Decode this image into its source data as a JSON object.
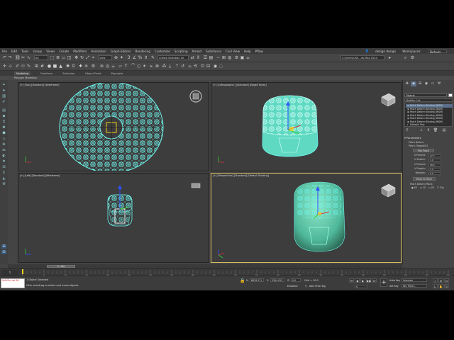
{
  "menubar": {
    "items": [
      "File",
      "Edit",
      "Tools",
      "Group",
      "Views",
      "Create",
      "Modifiers",
      "Animation",
      "Graph Editors",
      "Rendering",
      "Customize",
      "Scripting",
      "Arnold",
      "Substance",
      "Civil View",
      "Help",
      "Pflow"
    ],
    "user": "design design",
    "workspaces_label": "Workspaces:",
    "workspace": "Default"
  },
  "toolbar": {
    "filter": "All",
    "view": "View",
    "selection_set": "Create Selection Se",
    "project_path": "C:\\Users\\USE...ds Max 2024"
  },
  "ribbon": {
    "tabs": [
      "Modeling",
      "Freeform",
      "Selection",
      "Object Paint",
      "Populate"
    ],
    "active": "Modeling",
    "sub": "Polygon Modeling"
  },
  "viewports": {
    "top": "[+] [Top] [Standard] [Wireframe]",
    "ortho": "[+] [Orthographic] [Standard] [Edged Faces]",
    "left": "[+] [Left] [Standard] [Wireframe]",
    "persp": "[+] [Perspective] [Standard] [Default Shading]"
  },
  "command_panel": {
    "object_name": "Objects",
    "modifier_list": "Modifier List",
    "stack": [
      "Patch Deform Binding (WSM)",
      "Patch Deform Binding (WSM)",
      "Patch Deform Binding (WSM)",
      "Patch Deform Binding (WSM)",
      "Patch Deform Binding (WSM)",
      "Patch Deform Binding (WSM)",
      "Editable Poly"
    ],
    "params_title": "Parameters",
    "patch_deform": "Patch Deform",
    "patch_name": "Patch: Teapot001",
    "pick_patch": "Pick Patch",
    "u_percent": {
      "label": "U Percent:",
      "value": "47.7"
    },
    "u_stretch": {
      "label": "U Stretch:",
      "value": "1.0"
    },
    "v_percent": {
      "label": "V Percent:",
      "value": "48.6"
    },
    "v_stretch": {
      "label": "V Stretch:",
      "value": "1.0"
    },
    "rotation": {
      "label": "Rotation:",
      "value": "0.0"
    },
    "move_to_patch": "Move to Patch",
    "deform_plane": "Patch Deform Plane:",
    "plane_options": [
      "XY",
      "YZ",
      "ZX"
    ],
    "flip": "Flip"
  },
  "time": {
    "slider": "0 / 100",
    "ticks": [
      "0",
      "5",
      "10",
      "15",
      "20",
      "25",
      "30",
      "35",
      "40",
      "45",
      "50",
      "55",
      "60",
      "65",
      "70",
      "75",
      "80",
      "85",
      "90",
      "95",
      "100"
    ]
  },
  "status": {
    "maxscript": "MAXScript Mi",
    "selected": "1 Object Selected",
    "prompt": "Click and drag to select and move objects",
    "x": {
      "label": "X:",
      "value": "8876.571"
    },
    "y": {
      "label": "Y:",
      "value": "3304.023"
    },
    "z": {
      "label": "Z:",
      "value": "0.0"
    },
    "grid": "Grid = 10.0",
    "enabled": "Enabled:",
    "add_time_tag": "Add Time Tag",
    "auto_key": "Auto Key",
    "set_key": "Set Key",
    "selected_opt": "Selected",
    "key_filters": "Key Filters...",
    "frame": "0"
  },
  "colors": {
    "wire": "#6ff5ee",
    "select": "#d8c060",
    "body": "#4fb89a"
  }
}
